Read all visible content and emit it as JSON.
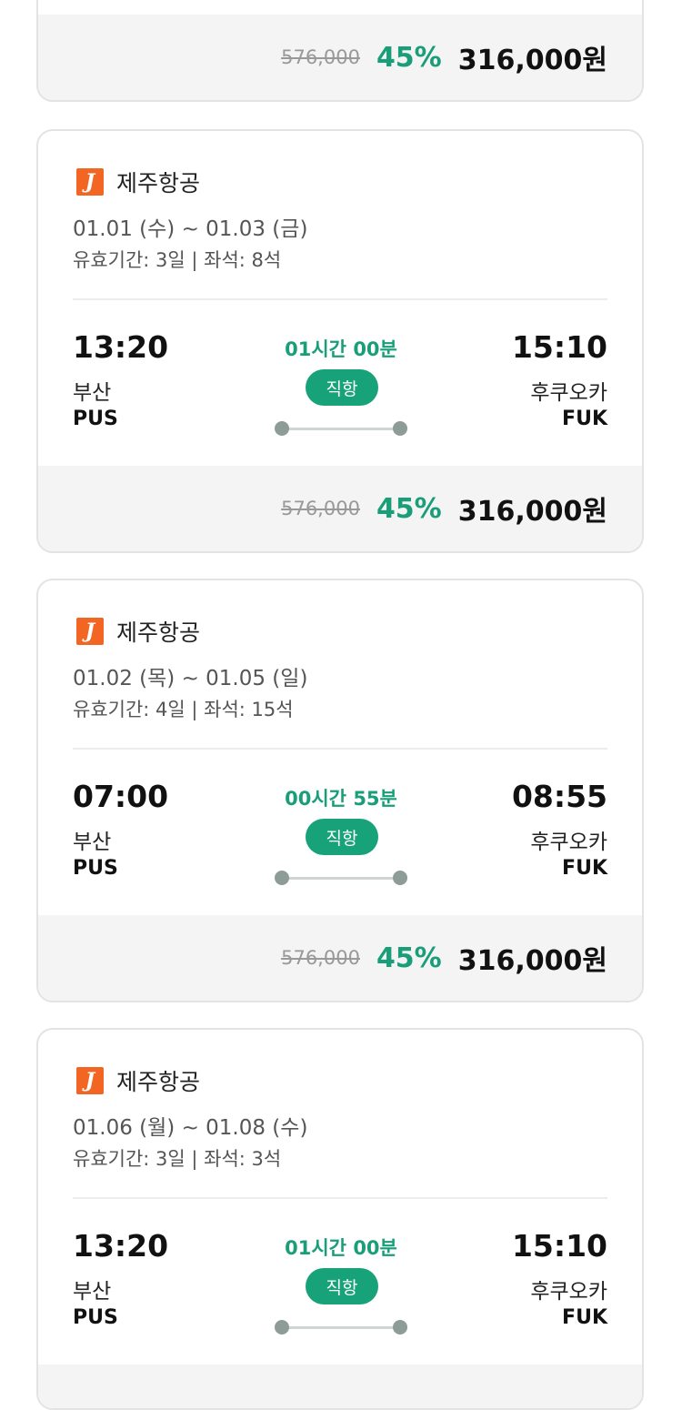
{
  "partial_card": {
    "original_price": "576,000",
    "discount": "45%",
    "final_price": "316,000원"
  },
  "cards": [
    {
      "airline": "제주항공",
      "logo_letter": "J",
      "dates": "01.01 (수) ~ 01.03 (금)",
      "meta": "유효기간: 3일 | 좌석: 8석",
      "dep_time": "13:20",
      "arr_time": "15:10",
      "duration": "01시간 00분",
      "badge": "직항",
      "dep_city": "부산",
      "arr_city": "후쿠오카",
      "dep_code": "PUS",
      "arr_code": "FUK",
      "original_price": "576,000",
      "discount": "45%",
      "final_price": "316,000원"
    },
    {
      "airline": "제주항공",
      "logo_letter": "J",
      "dates": "01.02 (목) ~ 01.05 (일)",
      "meta": "유효기간: 4일 | 좌석: 15석",
      "dep_time": "07:00",
      "arr_time": "08:55",
      "duration": "00시간 55분",
      "badge": "직항",
      "dep_city": "부산",
      "arr_city": "후쿠오카",
      "dep_code": "PUS",
      "arr_code": "FUK",
      "original_price": "576,000",
      "discount": "45%",
      "final_price": "316,000원"
    },
    {
      "airline": "제주항공",
      "logo_letter": "J",
      "dates": "01.06 (월) ~ 01.08 (수)",
      "meta": "유효기간: 3일 | 좌석: 3석",
      "dep_time": "13:20",
      "arr_time": "15:10",
      "duration": "01시간 00분",
      "badge": "직항",
      "dep_city": "부산",
      "arr_city": "후쿠오카",
      "dep_code": "PUS",
      "arr_code": "FUK"
    }
  ],
  "colors": {
    "accent_green": "#17a27a",
    "logo_orange": "#f26522"
  }
}
